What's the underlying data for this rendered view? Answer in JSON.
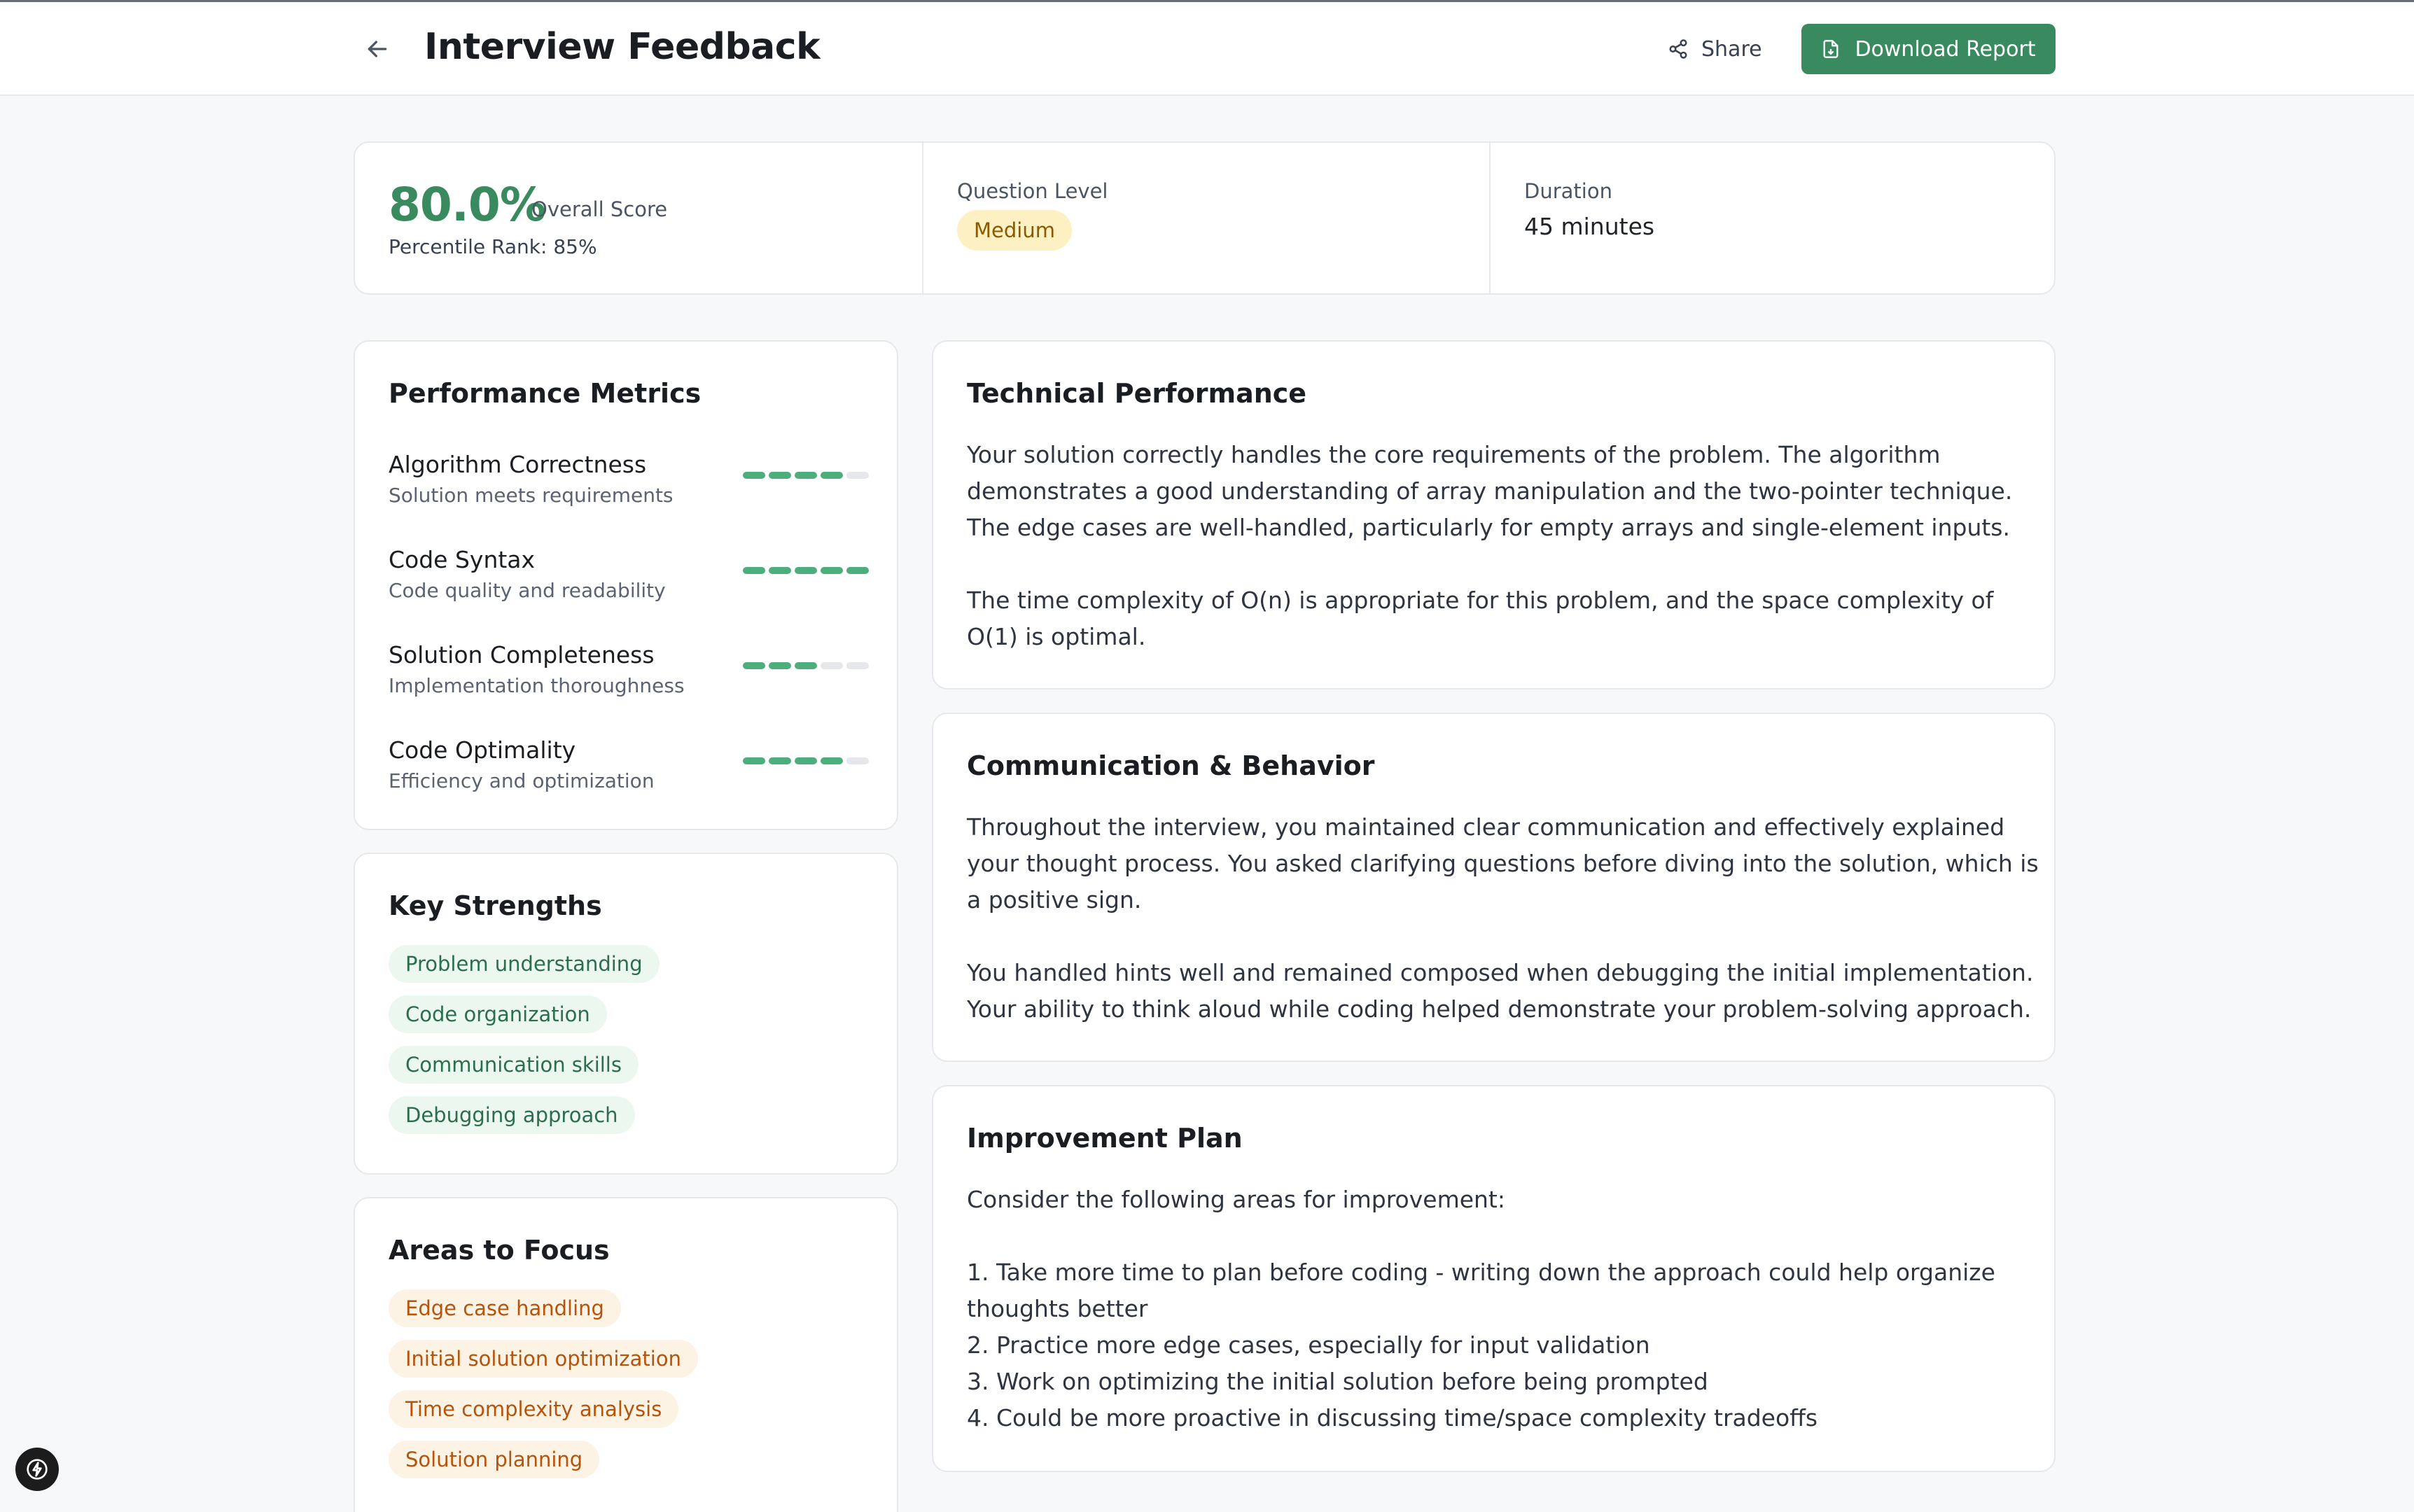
{
  "header": {
    "title": "Interview Feedback",
    "share_label": "Share",
    "download_label": "Download Report"
  },
  "summary": {
    "score": "80.0%",
    "score_label": "Overall Score",
    "percentile": "Percentile Rank: 85%",
    "level_label": "Question Level",
    "level_value": "Medium",
    "duration_label": "Duration",
    "duration_value": "45 minutes"
  },
  "metrics": {
    "title": "Performance Metrics",
    "items": [
      {
        "name": "Algorithm Correctness",
        "desc": "Solution meets requirements",
        "score": 4,
        "max": 5
      },
      {
        "name": "Code Syntax",
        "desc": "Code quality and readability",
        "score": 5,
        "max": 5
      },
      {
        "name": "Solution Completeness",
        "desc": "Implementation thoroughness",
        "score": 3,
        "max": 5
      },
      {
        "name": "Code Optimality",
        "desc": "Efficiency and optimization",
        "score": 4,
        "max": 5
      }
    ]
  },
  "strengths": {
    "title": "Key Strengths",
    "items": [
      "Problem understanding",
      "Code organization",
      "Communication skills",
      "Debugging approach"
    ]
  },
  "focus": {
    "title": "Areas to Focus",
    "items": [
      "Edge case handling",
      "Initial solution optimization",
      "Time complexity analysis",
      "Solution planning"
    ]
  },
  "technical": {
    "title": "Technical Performance",
    "p1": "Your solution correctly handles the core requirements of the problem. The algorithm demonstrates a good understanding of array manipulation and the two-pointer technique. The edge cases are well-handled, particularly for empty arrays and single-element inputs.",
    "p2": "The time complexity of O(n) is appropriate for this problem, and the space complexity of O(1) is optimal."
  },
  "communication": {
    "title": "Communication & Behavior",
    "p1": "Throughout the interview, you maintained clear communication and effectively explained your thought process. You asked clarifying questions before diving into the solution, which is a positive sign.",
    "p2": "You handled hints well and remained composed when debugging the initial implementation. Your ability to think aloud while coding helped demonstrate your problem-solving approach."
  },
  "improvement": {
    "title": "Improvement Plan",
    "intro": "Consider the following areas for improvement:",
    "items": [
      "1. Take more time to plan before coding - writing down the approach could help organize thoughts better",
      "2. Practice more edge cases, especially for input validation",
      "3. Work on optimizing the initial solution before being prompted",
      "4. Could be more proactive in discussing time/space complexity tradeoffs"
    ]
  },
  "colors": {
    "accent": "#3a8a5f",
    "metric_on": "#4cae7a",
    "metric_off": "#e5e7eb",
    "strength_bg": "#ecf7f0",
    "focus_bg": "#fdf3e4",
    "level_bg": "#fdf1c4"
  },
  "icons": {
    "back": "arrow-left-icon",
    "share": "share-icon",
    "download": "file-download-icon",
    "fab": "lightning-icon"
  }
}
